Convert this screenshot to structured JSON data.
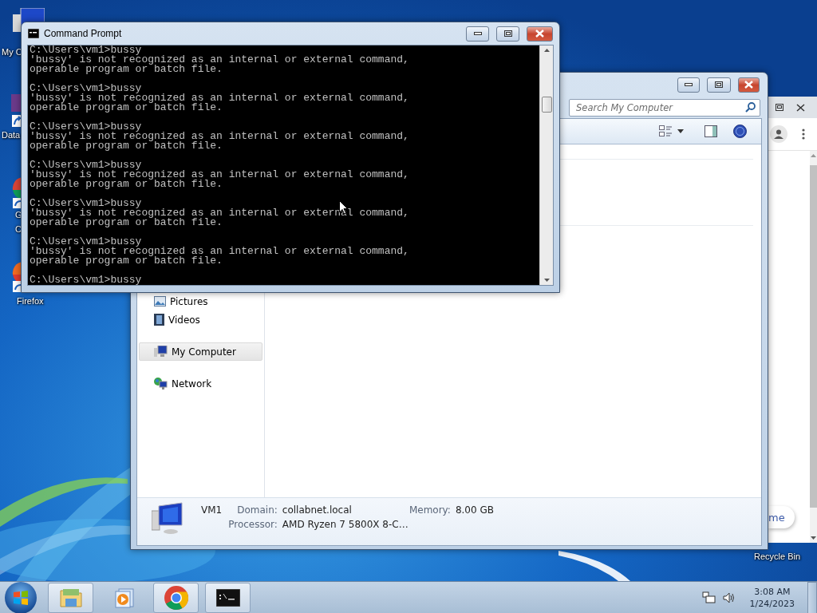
{
  "desktop_icons": [
    {
      "kind": "computer",
      "lines": [
        "My C"
      ]
    },
    {
      "kind": "shortcut",
      "lines": [
        "Data"
      ]
    },
    {
      "kind": "chrome",
      "lines": [
        "G",
        "C"
      ]
    },
    {
      "kind": "firefox",
      "lines": [
        "Firefox"
      ]
    },
    {
      "kind": "recycle",
      "lines": [
        "Recycle Bin"
      ]
    }
  ],
  "browser_window": {
    "action_button": "me"
  },
  "explorer": {
    "search": {
      "placeholder": "Search My Computer"
    },
    "nav": [
      {
        "children": [
          {
            "label": "Pictures",
            "kind": "pictures",
            "selected": false
          },
          {
            "label": "Videos",
            "kind": "videos",
            "selected": false
          }
        ]
      },
      {
        "label": "My Computer",
        "kind": "computer",
        "selected": true
      },
      {
        "label": "Network",
        "kind": "network",
        "selected": false
      }
    ],
    "details": {
      "name": "VM1",
      "fields": [
        {
          "label": "Domain:",
          "value": "collabnet.local"
        },
        {
          "label": "Memory:",
          "value": "8.00 GB"
        },
        {
          "label": "Processor:",
          "value": "AMD Ryzen 7 5800X 8-C…"
        }
      ]
    }
  },
  "command_prompt": {
    "title": "Command Prompt",
    "blocks": [
      {
        "command": "C:\\Users\\vm1>bussy",
        "output": [
          "'bussy' is not recognized as an internal or external command,",
          "operable program or batch file."
        ]
      },
      {
        "command": "C:\\Users\\vm1>bussy",
        "output": [
          "'bussy' is not recognized as an internal or external command,",
          "operable program or batch file."
        ]
      },
      {
        "command": "C:\\Users\\vm1>bussy",
        "output": [
          "'bussy' is not recognized as an internal or external command,",
          "operable program or batch file."
        ]
      },
      {
        "command": "C:\\Users\\vm1>bussy",
        "output": [
          "'bussy' is not recognized as an internal or external command,",
          "operable program or batch file."
        ]
      },
      {
        "command": "C:\\Users\\vm1>bussy",
        "output": [
          "'bussy' is not recognized as an internal or external command,",
          "operable program or batch file."
        ]
      },
      {
        "command": "C:\\Users\\vm1>bussy",
        "output": [
          "'bussy' is not recognized as an internal or external command,",
          "operable program or batch file."
        ]
      },
      {
        "command": "C:\\Users\\vm1>bussy"
      }
    ]
  },
  "taskbar": {
    "apps": [
      {
        "kind": "explorer",
        "running": true
      },
      {
        "kind": "media",
        "running": false
      },
      {
        "kind": "chrome",
        "running": true
      },
      {
        "kind": "cmd",
        "running": true
      }
    ],
    "clock": {
      "time": "3:08 AM",
      "date": "1/24/2023"
    }
  }
}
